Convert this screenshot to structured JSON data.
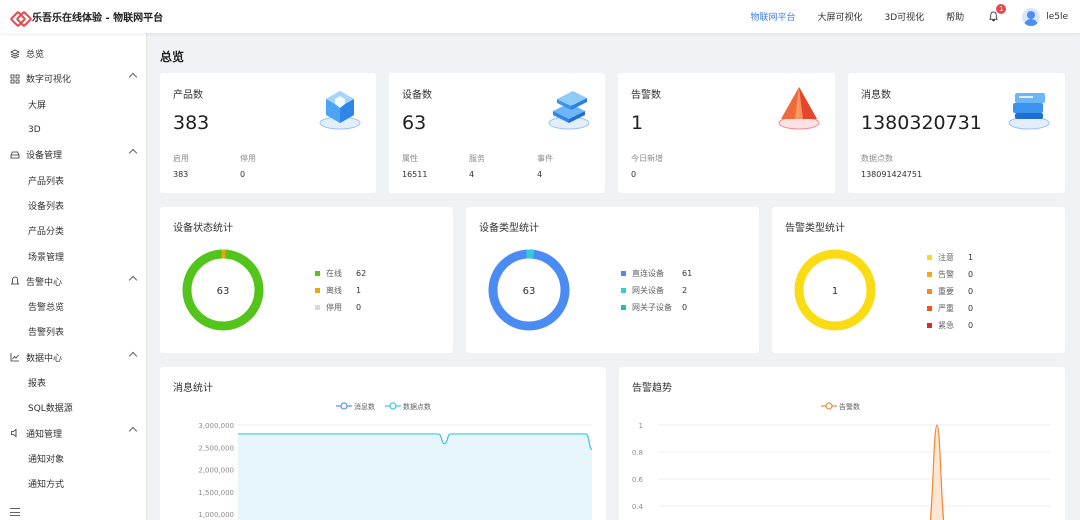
{
  "header": {
    "app_title": "乐吾乐在线体验 - 物联网平台",
    "nav": [
      {
        "label": "物联网平台",
        "active": true
      },
      {
        "label": "大屏可视化",
        "active": false
      },
      {
        "label": "3D可视化",
        "active": false
      },
      {
        "label": "帮助",
        "active": false
      }
    ],
    "notification_count": "1",
    "username": "le5le"
  },
  "sidebar": {
    "items": [
      {
        "label": "总览",
        "level": "top",
        "icon": "layers-icon"
      },
      {
        "label": "数字可视化",
        "level": "top",
        "icon": "grid-icon",
        "expanded": true
      },
      {
        "label": "大屏",
        "level": "sub"
      },
      {
        "label": "3D",
        "level": "sub"
      },
      {
        "label": "设备管理",
        "level": "top",
        "icon": "device-icon",
        "expanded": true
      },
      {
        "label": "产品列表",
        "level": "sub"
      },
      {
        "label": "设备列表",
        "level": "sub"
      },
      {
        "label": "产品分类",
        "level": "sub"
      },
      {
        "label": "场景管理",
        "level": "sub"
      },
      {
        "label": "告警中心",
        "level": "top",
        "icon": "bell-icon",
        "expanded": true
      },
      {
        "label": "告警总览",
        "level": "sub"
      },
      {
        "label": "告警列表",
        "level": "sub"
      },
      {
        "label": "数据中心",
        "level": "top",
        "icon": "line-chart-icon",
        "expanded": true
      },
      {
        "label": "报表",
        "level": "sub"
      },
      {
        "label": "SQL数据源",
        "level": "sub"
      },
      {
        "label": "通知管理",
        "level": "top",
        "icon": "speaker-icon",
        "expanded": true
      },
      {
        "label": "通知对象",
        "level": "sub"
      },
      {
        "label": "通知方式",
        "level": "sub"
      }
    ]
  },
  "page_title": "总览",
  "stats": [
    {
      "title": "产品数",
      "value": "383",
      "icon": "shield-cube-icon",
      "subs": [
        {
          "label": "启用",
          "value": "383"
        },
        {
          "label": "停用",
          "value": "0"
        }
      ]
    },
    {
      "title": "设备数",
      "value": "63",
      "icon": "device-stack-icon",
      "subs": [
        {
          "label": "属性",
          "value": "16511"
        },
        {
          "label": "服务",
          "value": "4"
        },
        {
          "label": "事件",
          "value": "4"
        }
      ]
    },
    {
      "title": "告警数",
      "value": "1",
      "icon": "warning-cone-icon",
      "subs": [
        {
          "label": "今日新增",
          "value": "0"
        }
      ]
    },
    {
      "title": "消息数",
      "value": "1380320731",
      "icon": "message-stack-icon",
      "subs": [
        {
          "label": "数据点数",
          "value": "138091424751"
        }
      ]
    }
  ],
  "donuts": [
    {
      "title": "设备状态统计",
      "center": "63",
      "legend": [
        {
          "name": "在线",
          "value": "62",
          "color": "#52c41a"
        },
        {
          "name": "离线",
          "value": "1",
          "color": "#e6a817"
        },
        {
          "name": "停用",
          "value": "0",
          "color": "#d9d9d9"
        }
      ]
    },
    {
      "title": "设备类型统计",
      "center": "63",
      "legend": [
        {
          "name": "直连设备",
          "value": "61",
          "color": "#4b8bf4"
        },
        {
          "name": "网关设备",
          "value": "2",
          "color": "#36c9e0"
        },
        {
          "name": "网关子设备",
          "value": "0",
          "color": "#1fbfae"
        }
      ]
    },
    {
      "title": "告警类型统计",
      "center": "1",
      "legend": [
        {
          "name": "注意",
          "value": "1",
          "color": "#fadb14"
        },
        {
          "name": "告警",
          "value": "0",
          "color": "#f5a623"
        },
        {
          "name": "重要",
          "value": "0",
          "color": "#fa8c16"
        },
        {
          "name": "严重",
          "value": "0",
          "color": "#f5541d"
        },
        {
          "name": "紧急",
          "value": "0",
          "color": "#e5252a"
        }
      ]
    }
  ],
  "message_chart": {
    "title": "消息统计",
    "chart_data": {
      "type": "area",
      "legend": [
        "消息数",
        "数据点数"
      ],
      "series_colors": [
        "#5b8ff9",
        "#36c9e0"
      ],
      "y_ticks": [
        "3,000,000",
        "2,500,000",
        "2,000,000",
        "1,500,000",
        "1,000,000"
      ],
      "ylim": [
        1000000,
        3000000
      ],
      "series": [
        {
          "name": "数据点数",
          "values": [
            2800000,
            2800000,
            2800000,
            2800000,
            2800000,
            2800000,
            2800000,
            2800000,
            2800000,
            2800000,
            2800000,
            2800000,
            2800000,
            2800000,
            2800000,
            2800000,
            2800000,
            2800000,
            2800000,
            2800000,
            2800000,
            2800000,
            2800000,
            2800000,
            2800000,
            2800000,
            2800000,
            2800000,
            2800000,
            2800000,
            2800000,
            2800000,
            2800000,
            2800000,
            2800000,
            2580000,
            2800000,
            2800000,
            2800000,
            2800000,
            2800000,
            2800000,
            2800000,
            2800000,
            2800000,
            2800000,
            2800000,
            2800000,
            2800000,
            2800000,
            2800000,
            2800000,
            2800000,
            2800000,
            2800000,
            2800000,
            2800000,
            2800000,
            2800000,
            2800000,
            2450000
          ]
        }
      ]
    }
  },
  "alarm_chart": {
    "title": "告警趋势",
    "chart_data": {
      "type": "line",
      "legend": [
        "告警数"
      ],
      "series_colors": [
        "#f08a3a"
      ],
      "y_ticks": [
        "1",
        "0.8",
        "0.6",
        "0.4"
      ],
      "ylim": [
        0.4,
        1
      ],
      "series": [
        {
          "name": "告警数",
          "peak_value": 1
        }
      ]
    }
  }
}
